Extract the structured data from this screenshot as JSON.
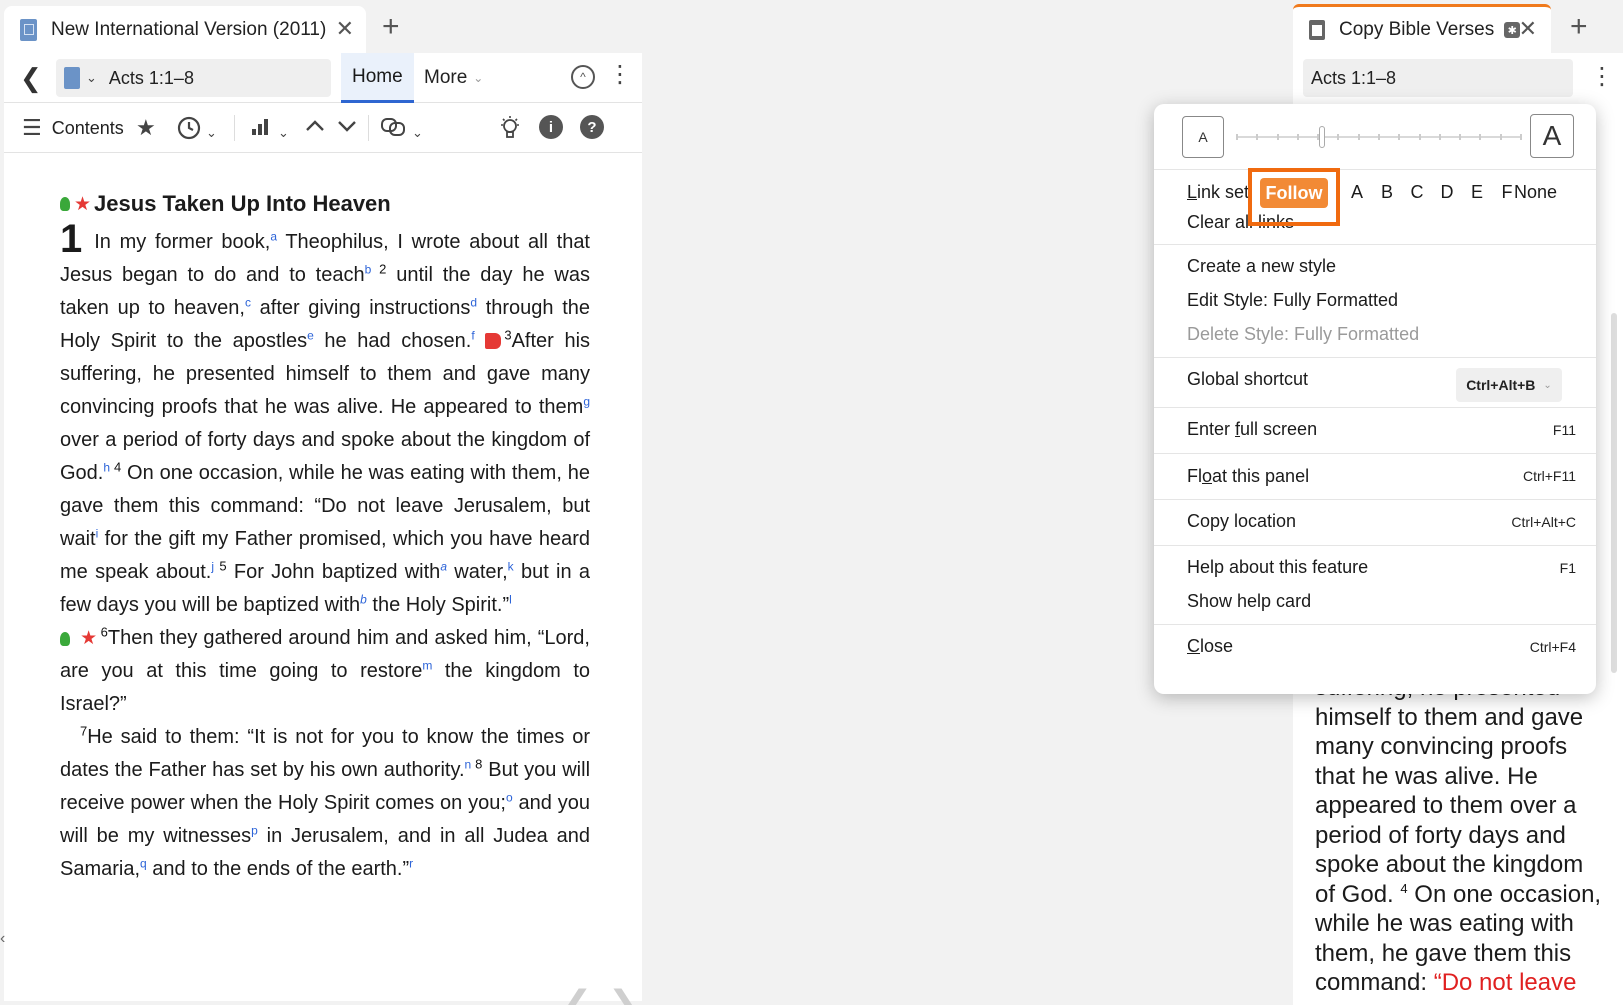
{
  "left_tab": {
    "title": "New International Version (2011)",
    "close": "✕",
    "add": "+"
  },
  "left_nav": {
    "back": "❮",
    "reference": "Acts 1:1–8",
    "ref_chevron": "⌄",
    "tab_home": "Home",
    "tab_more": "More",
    "more_chevron": "⌄",
    "up_icon": "^",
    "kebab": "⋮"
  },
  "toolbar": {
    "contents_label": "Contents",
    "icons": [
      "menu-lines-icon",
      "star-icon",
      "history-icon",
      "chart-icon",
      "arrow-up-icon",
      "arrow-down-icon",
      "link-icon",
      "lightbulb-icon",
      "info-icon",
      "help-icon"
    ]
  },
  "bible": {
    "heading": "Jesus Taken Up Into Heaven",
    "chapter": "1",
    "p1": {
      "t1": "In my former book,",
      "f_a": "a",
      "t2": " Theophilus, I wrote about all that Jesus began to do and to teach",
      "f_b": "b",
      "v2": " 2",
      "t3": " until the day he was taken up to heaven,",
      "f_c": "c",
      "t4": " after giving instructions",
      "f_d": "d",
      "t5": " through the Holy Spirit to the apostles",
      "f_e": "e",
      "t6": " he had chosen.",
      "f_f": "f",
      "v3": "3",
      "t7": "After his suffering, he presented himself to them and gave many convincing proofs that he was alive. He appeared to them",
      "f_g": "g",
      "t8": " over a period of forty days and spoke about the kingdom of God.",
      "f_h": "h",
      "v4": " 4",
      "t9": "On one occasion, while he was eating with them, he gave them this command: “Do not leave Jerusalem, but wait",
      "f_i": "i",
      "t10": " for the gift my Father promised, which you have heard me speak about.",
      "f_j": "j",
      "v5": " 5",
      "t11": "For John baptized with",
      "f_a2": "a",
      "t12": " water,",
      "f_k": "k",
      "t13": " but in a few days you will be baptized with",
      "f_b2": "b",
      "t14": " the Holy Spirit.”",
      "f_l": "l"
    },
    "p2": {
      "v6": "6",
      "t1": "Then they gathered around him and asked him, “Lord, are you at this time going to restore",
      "f_m": "m",
      "t2": " the kingdom to Israel?”"
    },
    "p3": {
      "v7": "7",
      "t1": "He said to them: “It is not for you to know the times or dates the Father has set by his own authority.",
      "f_n": "n",
      "v8": " 8",
      "t2": "But you will receive power when the Holy Spirit comes on you;",
      "f_o": "o",
      "t3": " and you will be my witnesses",
      "f_p": "p",
      "t4": " in Jerusalem, and in all Judea and Samaria,",
      "f_q": "q",
      "t5": " and to the ends of the earth.”",
      "f_r": "r"
    },
    "pager_prev": "❮",
    "pager_next": "❯"
  },
  "right_tab": {
    "title": "Copy Bible Verses",
    "pin": "✱",
    "close": "✕",
    "add": "+"
  },
  "right_panel": {
    "reference": "Acts 1:1–8",
    "kebab": "⋮",
    "text_black": "suffering, he presented himself to them and gave many convincing proofs that he was alive. He appeared to them over a period of forty days and spoke about the kingdom of God.",
    "v4": "4",
    "text_black2": " On one occasion, while he was eating with them, he gave them this command: ",
    "text_red": "“Do not leave"
  },
  "menu": {
    "font_small": "A",
    "font_large": "A",
    "font_size_level": 0.3,
    "link_set_label": "Link set",
    "follow": "Follow",
    "letters": [
      "A",
      "B",
      "C",
      "D",
      "E",
      "F"
    ],
    "none": "None",
    "clear_all": "Clear all links",
    "create_style": "Create a new style",
    "edit_style": "Edit Style: Fully Formatted",
    "delete_style": "Delete Style: Fully Formatted",
    "global_shortcut": "Global shortcut",
    "global_shortcut_value": "Ctrl+Alt+B",
    "enter_full_screen": "Enter full screen",
    "enter_full_screen_sc": "F11",
    "float_panel": "Float this panel",
    "float_panel_sc": "Ctrl+F11",
    "copy_location": "Copy location",
    "copy_location_sc": "Ctrl+Alt+C",
    "help_feature": "Help about this feature",
    "help_feature_sc": "F1",
    "show_help_card": "Show help card",
    "close": "Close",
    "close_sc": "Ctrl+F4"
  },
  "colors": {
    "accent_blue": "#2e66d1",
    "follow_orange": "#f28a35",
    "highlight_orange": "#f06a0f",
    "red_text": "#e02020",
    "star_red": "#e53935",
    "bulb_green": "#3aa83a"
  }
}
